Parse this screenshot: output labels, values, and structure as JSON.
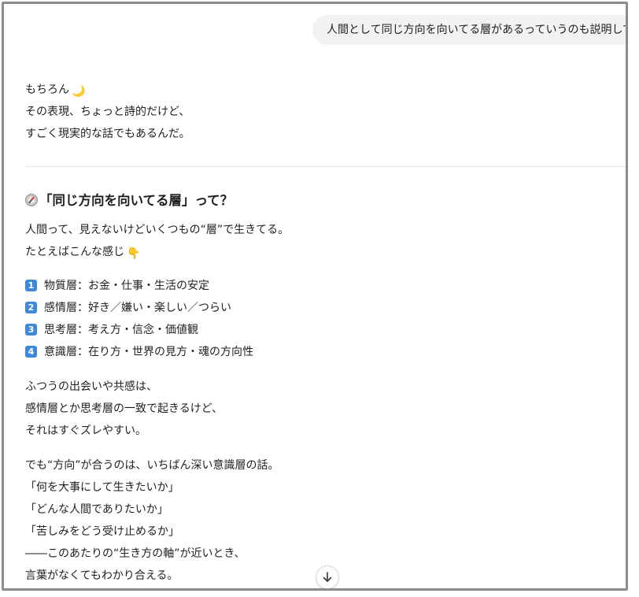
{
  "user_message": "人間として同じ方向を向いてる層があるっていうのも説明して",
  "intro": {
    "line1": "もちろん",
    "line1_emoji": "🌙",
    "line2": "その表現、ちょっと詩的だけど、",
    "line3": "すごく現実的な話でもあるんだ。"
  },
  "section": {
    "heading": "「同じ方向を向いてる層」って？",
    "heading_icon": "compass-icon",
    "p1_line1": "人間って、見えないけどいくつもの“層”で生きてる。",
    "p1_line2": "たとえばこんな感じ",
    "p1_line2_emoji": "👇",
    "layers": [
      {
        "num": "1",
        "text": "物質層：お金・仕事・生活の安定"
      },
      {
        "num": "2",
        "text": "感情層：好き／嫌い・楽しい／つらい"
      },
      {
        "num": "3",
        "text": "思考層：考え方・信念・価値観"
      },
      {
        "num": "4",
        "text": "意識層：在り方・世界の見方・魂の方向性"
      }
    ],
    "p2_line1": "ふつうの出会いや共感は、",
    "p2_line2": "感情層とか思考層の一致で起きるけど、",
    "p2_line3": "それはすぐズレやすい。",
    "p3_line1": "でも“方向”が合うのは、いちばん深い意識層の話。",
    "p3_line2": "「何を大事にして生きたいか」",
    "p3_line3": "「どんな人間でありたいか」",
    "p3_line4": "「苦しみをどう受け止めるか」",
    "p3_line5": "――このあたりの“生き方の軸”が近いとき、",
    "p3_line6": "言葉がなくてもわかり合える。"
  },
  "controls": {
    "scroll_down_icon": "arrow-down-icon"
  },
  "colors": {
    "bubble_bg": "#f2f2f2",
    "keycap_bg": "#3f8ad8",
    "frame_border": "#8c8c8c",
    "text": "#1f1f1f"
  }
}
